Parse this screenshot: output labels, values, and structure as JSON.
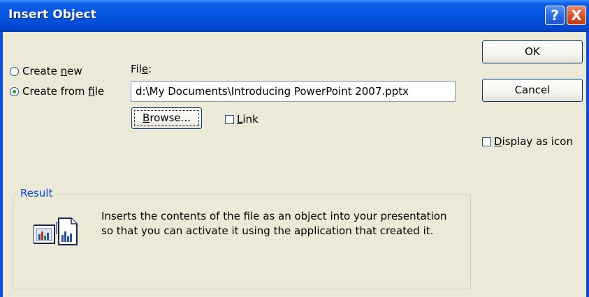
{
  "window": {
    "title": "Insert Object"
  },
  "titlebar_buttons": {
    "help": "?",
    "close": "X"
  },
  "options": {
    "create_new": {
      "label_before": "Create ",
      "label_access": "n",
      "label_after": "ew",
      "selected": false
    },
    "create_from_file": {
      "label_before": "Create from ",
      "label_access": "f",
      "label_after": "ile",
      "selected": true
    }
  },
  "file": {
    "label_before": "Fil",
    "label_access": "e",
    "label_after": ":",
    "value": "d:\\My Documents\\Introducing PowerPoint 2007.pptx"
  },
  "browse_button": {
    "label_access": "B",
    "label_after": "rowse..."
  },
  "link_checkbox": {
    "label_access": "L",
    "label_after": "ink",
    "checked": false
  },
  "ok_button": {
    "label": "OK"
  },
  "cancel_button": {
    "label": "Cancel"
  },
  "display_as_icon": {
    "label_access": "D",
    "label_after": "isplay as icon",
    "checked": false
  },
  "result": {
    "label": "Result",
    "line1": "Inserts the contents of the file as an object into your presentation",
    "line2": "so that you can activate it using the application that created it."
  }
}
